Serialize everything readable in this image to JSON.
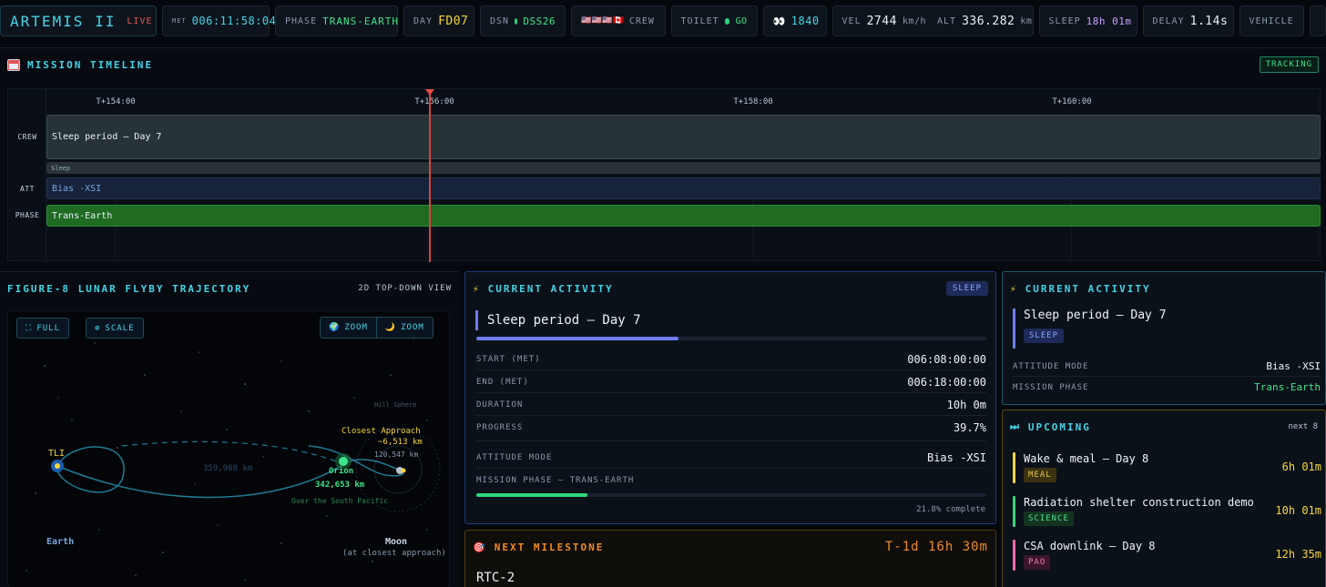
{
  "topbar": {
    "mission": "ARTEMIS II",
    "live": "LIVE",
    "met_label": "MET",
    "met_value": "006:11:58:04",
    "phase_label": "PHASE",
    "phase_value": "TRANS-EARTH",
    "day_label": "DAY",
    "day_value": "FD07",
    "dsn_label": "DSN",
    "dsn_value": "DSS26",
    "crew_flags": "🇺🇸🇺🇸🇺🇸🇨🇦",
    "crew_label": "CREW",
    "toilet_label": "TOILET",
    "toilet_value": "GO",
    "eyes_icon": "👀",
    "eyes_value": "1840",
    "vel_label": "VEL",
    "vel_value": "2744",
    "vel_unit": "km/h",
    "alt_label": "ALT",
    "alt_value": "336.282",
    "alt_unit": "km",
    "sleep_label": "SLEEP",
    "sleep_value": "18h 01m",
    "delay_label": "DELAY",
    "delay_value": "1.14s",
    "vehicle_label": "VEHICLE"
  },
  "timeline": {
    "title": "MISSION TIMELINE",
    "status": "TRACKING",
    "ticks": [
      "T+154:00",
      "T+156:00",
      "T+158:00",
      "T+160:00"
    ],
    "lanes": [
      "CREW",
      "ATT",
      "PHASE"
    ],
    "crew_bar": "Sleep period — Day 7",
    "crew_sub": "Sleep",
    "att_bar": "Bias -XSI",
    "phase_bar": "Trans-Earth"
  },
  "trajectory": {
    "title": "FIGURE-8 LUNAR FLYBY TRAJECTORY",
    "view": "2D TOP-DOWN VIEW",
    "btn_full": "FULL",
    "btn_scale": "SCALE",
    "btn_zoom_earth": "ZOOM",
    "btn_zoom_moon": "ZOOM",
    "tli": "TLI",
    "earth": "Earth",
    "moon": "Moon",
    "moon_sub": "(at closest approach)",
    "hill": "Hill Sphere",
    "closest": "Closest Approach",
    "closest_dist": "~6,513 km",
    "moon_dist": "120,547 km",
    "earth_moon_dist": "359,988 km",
    "orion": "Orion",
    "orion_dist": "342,653 km",
    "orion_loc": "Over the South Pacific"
  },
  "activity": {
    "title": "CURRENT ACTIVITY",
    "badge": "SLEEP",
    "name": "Sleep period — Day 7",
    "progress": 0.397,
    "rows": [
      {
        "k": "START (MET)",
        "v": "006:08:00:00"
      },
      {
        "k": "END (MET)",
        "v": "006:18:00:00"
      },
      {
        "k": "DURATION",
        "v": "10h 0m"
      },
      {
        "k": "PROGRESS",
        "v": "39.7%"
      }
    ],
    "att_label": "ATTITUDE MODE",
    "att_value": "Bias -XSI",
    "phase_label": "MISSION PHASE — TRANS-EARTH",
    "phase_progress": 0.218,
    "phase_note": "21.8% complete"
  },
  "milestone": {
    "title": "NEXT MILESTONE",
    "countdown": "T-1d 16h 30m",
    "name": "RTC-2"
  },
  "side_activity": {
    "title": "CURRENT ACTIVITY",
    "name": "Sleep period — Day 7",
    "badge": "SLEEP",
    "att_label": "ATTITUDE MODE",
    "att_value": "Bias -XSI",
    "phase_label": "MISSION PHASE",
    "phase_value": "Trans-Earth"
  },
  "upcoming": {
    "title": "UPCOMING",
    "next": "next 8",
    "items": [
      {
        "name": "Wake & meal — Day 8",
        "tag": "MEAL",
        "time": "6h 01m",
        "color": "#f5d53b",
        "tag_bg": "#3a3210",
        "tag_fg": "#e8c94a"
      },
      {
        "name": "Radiation shelter construction demo",
        "tag": "SCIENCE",
        "time": "10h 01m",
        "color": "#2fd67a",
        "tag_bg": "#12331f",
        "tag_fg": "#4fe08f"
      },
      {
        "name": "CSA downlink — Day 8",
        "tag": "PAO",
        "time": "12h 35m",
        "color": "#f06aa8",
        "tag_bg": "#3a1628",
        "tag_fg": "#f27ab5"
      }
    ]
  }
}
